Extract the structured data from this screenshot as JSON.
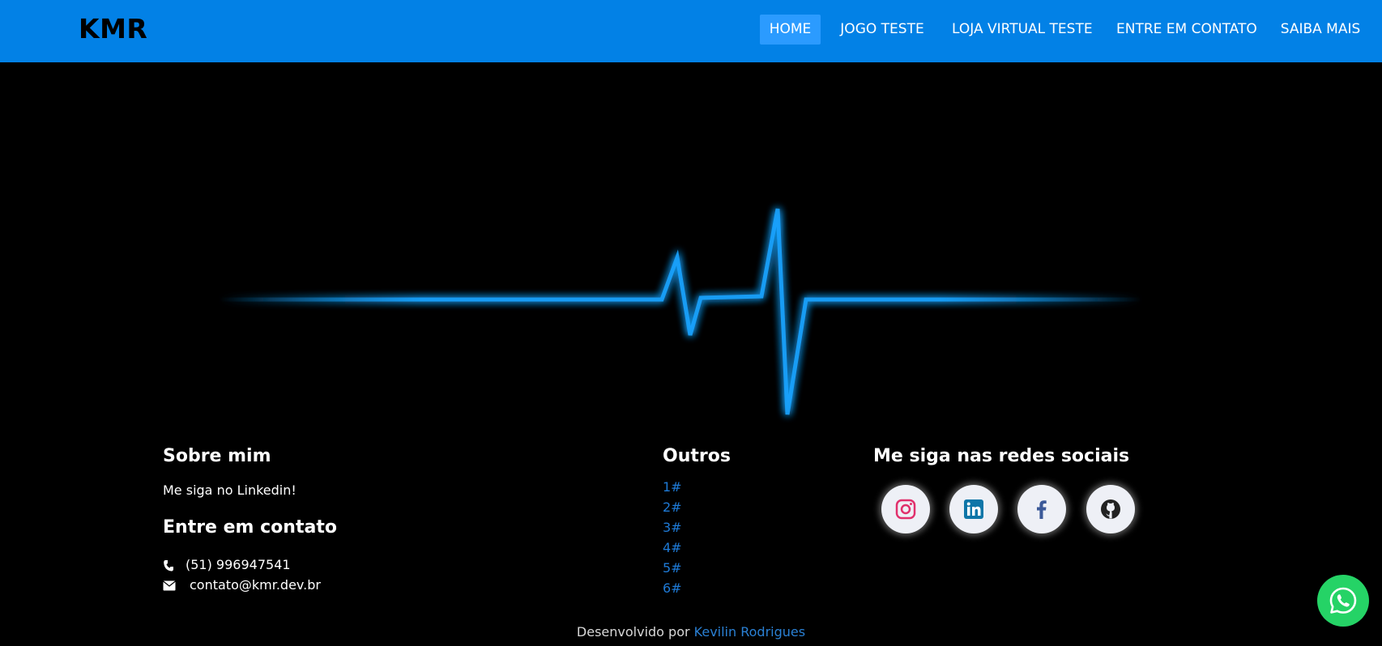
{
  "navbar": {
    "brand": "KMR",
    "items": [
      {
        "label": "HOME",
        "active": true
      },
      {
        "label": "JOGO TESTE"
      },
      {
        "label": "LOJA VIRTUAL TESTE"
      },
      {
        "label": "ENTRE EM CONTATO"
      },
      {
        "label": "SAIBA MAIS"
      }
    ],
    "color": "#0281e6"
  },
  "hero": {
    "graphic": "heartbeat-line",
    "line_color": "#1aa3ff"
  },
  "footer": {
    "about": {
      "heading": "Sobre mim",
      "text": "Me siga no Linkedin!"
    },
    "contact": {
      "heading": "Entre em contato",
      "phone": "(51) 996947541",
      "email": "contato@kmr.dev.br",
      "phone_icon": "phone-icon",
      "email_icon": "envelope-icon"
    },
    "others": {
      "heading": "Outros",
      "links": [
        "1#",
        "2#",
        "3#",
        "4#",
        "5#",
        "6#"
      ]
    },
    "social": {
      "heading": "Me siga nas redes sociais",
      "icons": [
        "instagram-icon",
        "linkedin-icon",
        "facebook-icon",
        "github-icon"
      ]
    },
    "credit": {
      "prefix": "Desenvolvido por",
      "author": "Kevilin Rodrigues"
    }
  },
  "whatsapp": {
    "icon": "whatsapp-icon",
    "color": "#25d366"
  }
}
